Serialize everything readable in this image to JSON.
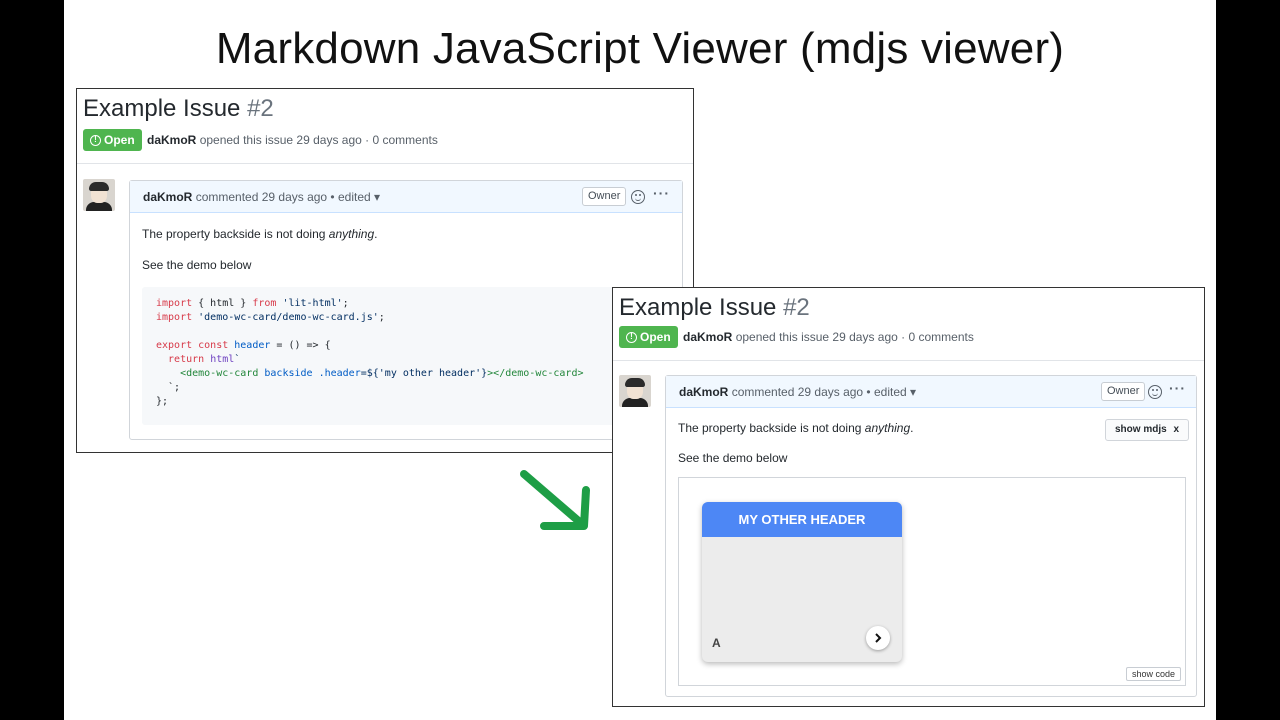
{
  "slide": {
    "title": "Markdown JavaScript Viewer (mdjs viewer)"
  },
  "issue": {
    "title": "Example Issue",
    "number": "#2",
    "status": "Open",
    "author": "daKmoR",
    "opened_text": "opened this issue 29 days ago · 0 comments"
  },
  "comment": {
    "author": "daKmoR",
    "meta_text": "commented 29 days ago • edited ▾",
    "owner_label": "Owner",
    "more_label": "···",
    "text_before": "The property backside is not doing ",
    "text_emphasis": "anything",
    "text_after": ".",
    "demo_intro": "See the demo below"
  },
  "code": {
    "lines": {
      "l1_import": "import",
      "l1_mid": " { html } ",
      "l1_from": "from",
      "l1_str": " 'lit-html'",
      "l1_end": ";",
      "l2_import": "import",
      "l2_str": " 'demo-wc-card/demo-wc-card.js'",
      "l2_end": ";",
      "l4_export": "export",
      "l4_const": " const",
      "l4_name": " header",
      "l4_rest": " = () => {",
      "l5_return": "  return",
      "l5_fn": " html",
      "l5_tick": "`",
      "l6_open": "    <demo-wc-card",
      "l6_attr": " backside .header",
      "l6_val": "=${'my other header'}",
      "l6_close": "></demo-wc-card>",
      "l7": "  `;",
      "l8": "};"
    }
  },
  "viewer": {
    "show_mdjs_label": "show mdjs",
    "show_mdjs_close": "x",
    "card_header": "MY OTHER HEADER",
    "card_letter": "A",
    "show_code_label": "show code"
  },
  "colors": {
    "open_badge": "#4fb54f",
    "card_header": "#4d87f5",
    "arrow": "#1e9e46"
  }
}
